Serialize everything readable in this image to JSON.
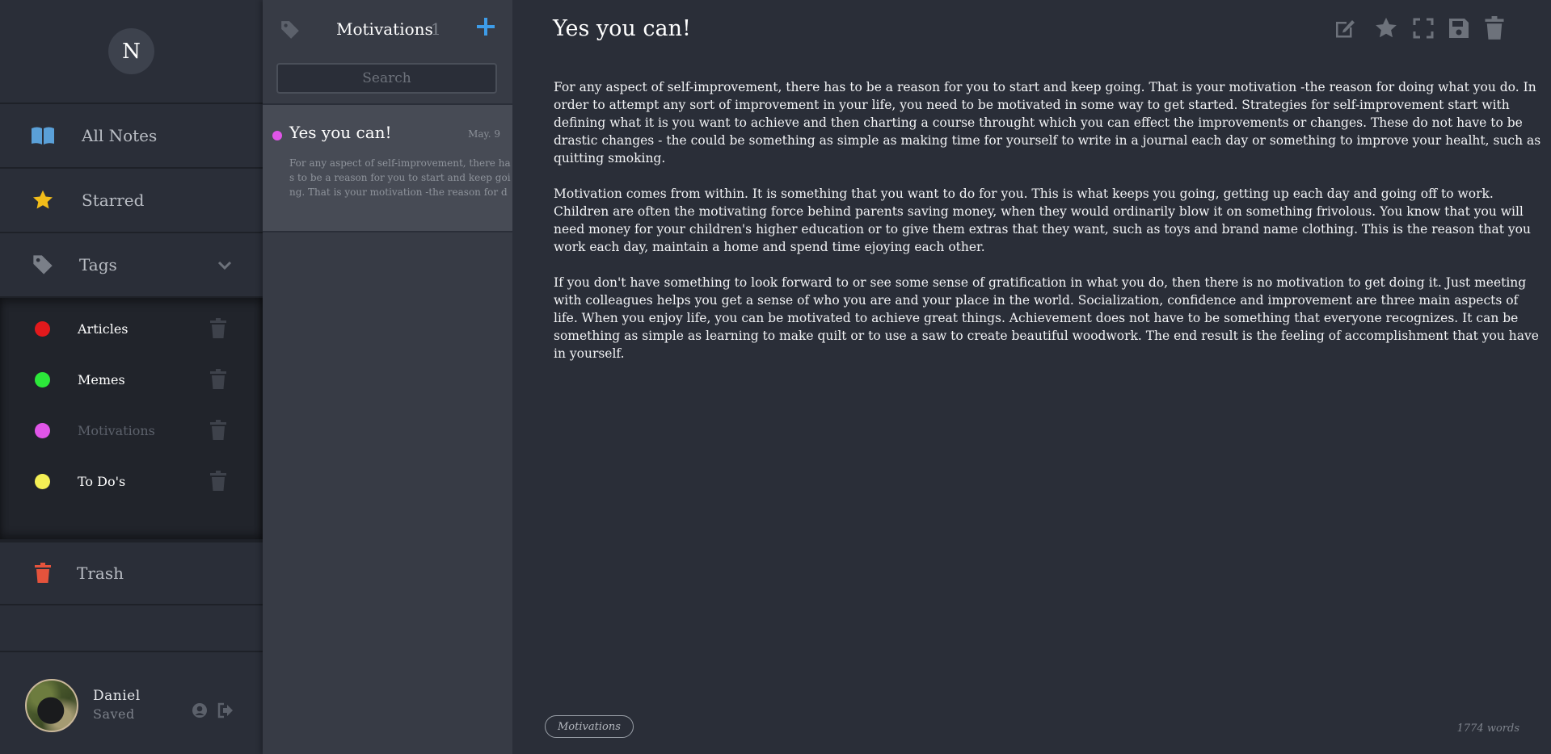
{
  "sidebar": {
    "logo_letter": "N",
    "nav": {
      "all_notes": "All Notes",
      "starred": "Starred",
      "tags": "Tags",
      "trash": "Trash"
    },
    "tags": [
      {
        "label": "Articles",
        "color": "#e3191c"
      },
      {
        "label": "Memes",
        "color": "#2ce83a"
      },
      {
        "label": "Motivations",
        "color": "#e055e8"
      },
      {
        "label": "To Do's",
        "color": "#f4ef55"
      }
    ],
    "user": {
      "name": "Daniel",
      "status": "Saved"
    }
  },
  "notes_list": {
    "title": "Motivations",
    "count": "1",
    "search_placeholder": "Search",
    "notes": [
      {
        "title": "Yes you can!",
        "date": "May. 9",
        "preview": "For any aspect of self-improvement, there has to be a reason for you to start and keep going. That is your motivation -the reason for doing ..."
      }
    ]
  },
  "editor": {
    "title": "Yes you can!",
    "paragraphs": [
      "For any aspect of self-improvement, there has to be a reason for you to start and keep going. That is your motivation -the reason for doing what you do. In order to attempt any sort of improvement in your life, you need to be motivated in some way to get started. Strategies for self-improvement start with defining what it is you want to achieve and then charting a course throught which you can effect the improvements or changes. These do not have to be drastic changes - the could be something as simple as making time for yourself to write in a journal each day or something to improve your healht, such as quitting smoking.",
      "Motivation comes from within. It is something that you want to do for you. This is what keeps you going, getting up each day and going off to work. Children are often the motivating force behind parents saving money, when they would ordinarily blow it on something frivolous. You know that you will need money for your children's higher education or to give them extras that they want, such as toys and brand name clothing. This is the reason that you work each day, maintain a home and spend time ejoying each other.",
      "If you don't have something to look forward  to or see some sense of gratification in what you do, then there is no motivation to get doing it. Just meeting with colleagues helps you get a sense of who you are and your place in the world. Socialization, confidence and improvement are three main aspects of life. When you enjoy life, you can be motivated to achieve great things. Achievement does not have to be something that everyone recognizes. It can be something as simple as learning to make quilt or to use a saw to create beautiful woodwork. The end result is the feeling of accomplishment that you have in yourself."
    ],
    "tag": "Motivations",
    "word_count": "1774 words"
  },
  "colors": {
    "accent_blue": "#3d9ce8",
    "star_yellow": "#f2bd1a",
    "trash_red": "#e5533c",
    "book_blue": "#5aa0d8"
  }
}
